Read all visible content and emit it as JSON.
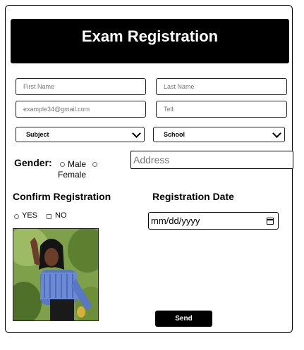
{
  "header": {
    "title": "Exam Registration"
  },
  "form": {
    "first_name": {
      "placeholder": "First Name"
    },
    "last_name": {
      "placeholder": "Last Name"
    },
    "email": {
      "placeholder": "example34@gmail.com"
    },
    "tel": {
      "placeholder": "Tell:"
    },
    "subject": {
      "selected": "Subject"
    },
    "school": {
      "selected": "School"
    },
    "gender": {
      "label": "Gender:",
      "options": [
        "Male",
        "Female"
      ]
    },
    "address": {
      "placeholder": "Address"
    },
    "confirm": {
      "label": "Confirm Registration",
      "options": [
        "YES",
        "NO"
      ]
    },
    "date": {
      "label": "Registration Date",
      "value": "mm/dd/yyyy"
    },
    "send_label": "Send"
  },
  "icons": [
    "chevron-down-icon",
    "calendar-icon"
  ]
}
